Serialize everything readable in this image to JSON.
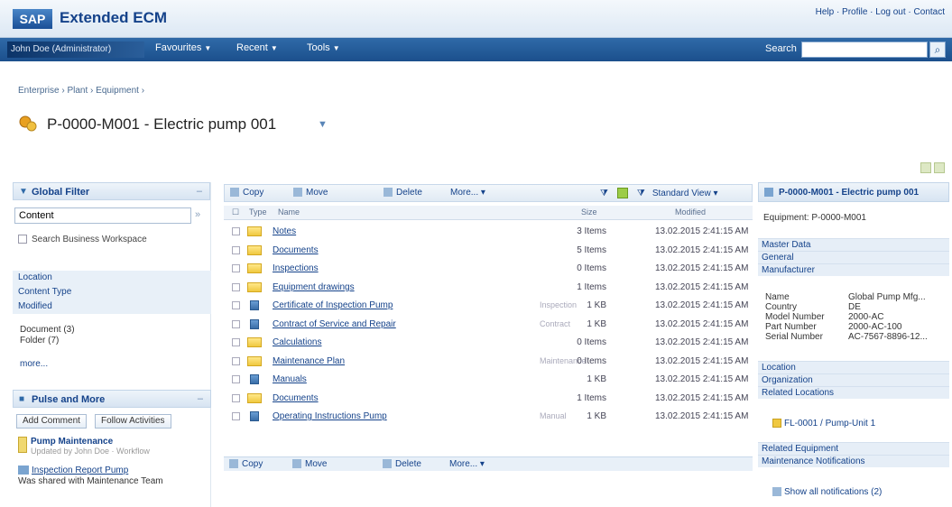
{
  "header": {
    "logo": "SAP",
    "app_title": "Extended ECM",
    "top_right": "Help · Profile · Log out · Contact"
  },
  "nav": {
    "user": "John Doe (Administrator)",
    "items": [
      "Favourites",
      "Recent",
      "Tools"
    ],
    "search_label": "Search",
    "search_placeholder": ""
  },
  "breadcrumb": "Enterprise › Plant › Equipment ›",
  "page_title": "P-0000-M001 - Electric pump 001",
  "left": {
    "filter_title": "Global Filter",
    "filter_value": "Content",
    "search_folder_label": "Search Business Workspace",
    "facets": [
      "Location",
      "Content Type",
      "Modified"
    ],
    "sub_items": [
      "Document (3)",
      "Folder (7)"
    ],
    "more": "more...",
    "panel2_title": "Pulse and More",
    "buttons": [
      "Add Comment",
      "Follow Activities"
    ],
    "recent_title": "Pump Maintenance",
    "recent_sub": "Updated by John Doe · Workflow",
    "recent_link": "Inspection Report Pump",
    "recent_desc": "Was shared with Maintenance Team"
  },
  "toolbar": {
    "buttons": [
      "Copy",
      "Move",
      "Delete",
      "More..."
    ],
    "view_select": "Standard View"
  },
  "columns": {
    "type": "Type",
    "name": "Name",
    "size": "Size",
    "modified": "Modified"
  },
  "rows": [
    {
      "type": "folder",
      "name": "Notes",
      "extra": "",
      "desc": "",
      "size": "3 Items",
      "date": "13.02.2015 2:41:15 AM"
    },
    {
      "type": "folder",
      "name": "Documents",
      "extra": "",
      "desc": "",
      "size": "5 Items",
      "date": "13.02.2015 2:41:15 AM"
    },
    {
      "type": "folder",
      "name": "Inspections",
      "extra": "",
      "desc": "",
      "size": "0 Items",
      "date": "13.02.2015 2:41:15 AM"
    },
    {
      "type": "folder",
      "name": "Equipment drawings",
      "extra": "",
      "desc": "",
      "size": "1 Items",
      "date": "13.02.2015 2:41:15 AM"
    },
    {
      "type": "doc",
      "name": "Certificate of Inspection Pump",
      "extra": "",
      "desc": "Inspection",
      "size": "1 KB",
      "date": "13.02.2015 2:41:15 AM"
    },
    {
      "type": "doc",
      "name": "Contract of Service and Repair",
      "extra": "",
      "desc": "Contract",
      "size": "1 KB",
      "date": "13.02.2015 2:41:15 AM"
    },
    {
      "type": "folder",
      "name": "Calculations",
      "extra": "",
      "desc": "",
      "size": "0 Items",
      "date": "13.02.2015 2:41:15 AM"
    },
    {
      "type": "folder",
      "name": "Maintenance Plan",
      "extra": "",
      "desc": "Maintenance",
      "size": "0 Items",
      "date": "13.02.2015 2:41:15 AM"
    },
    {
      "type": "doc",
      "name": "Manuals",
      "extra": "",
      "desc": "",
      "size": "1 KB",
      "date": "13.02.2015 2:41:15 AM"
    },
    {
      "type": "folder",
      "name": "Documents",
      "extra": "",
      "desc": "",
      "size": "1 Items",
      "date": "13.02.2015 2:41:15 AM"
    },
    {
      "type": "doc",
      "name": "Operating Instructions Pump",
      "extra": "",
      "desc": "Manual",
      "size": "1 KB",
      "date": "13.02.2015 2:41:15 AM"
    }
  ],
  "right": {
    "title": "P-0000-M001 - Electric pump 001",
    "equipment": "Equipment: P-0000-M001",
    "sections": [
      "Master Data",
      "General",
      "Manufacturer"
    ],
    "kv": [
      [
        "Name",
        "Global Pump Mfg..."
      ],
      [
        "Country",
        "DE"
      ],
      [
        "Model Number",
        "2000-AC"
      ],
      [
        "Part Number",
        "2000-AC-100"
      ],
      [
        "Serial Number",
        "AC-7567-8896-12..."
      ]
    ],
    "sections2": [
      "Location",
      "Organization",
      "Related Locations"
    ],
    "related_link": "FL-0001 / Pump-Unit 1",
    "sections3": [
      "Related Equipment",
      "Maintenance Notifications"
    ],
    "notification_link": "Show all notifications (2)"
  }
}
